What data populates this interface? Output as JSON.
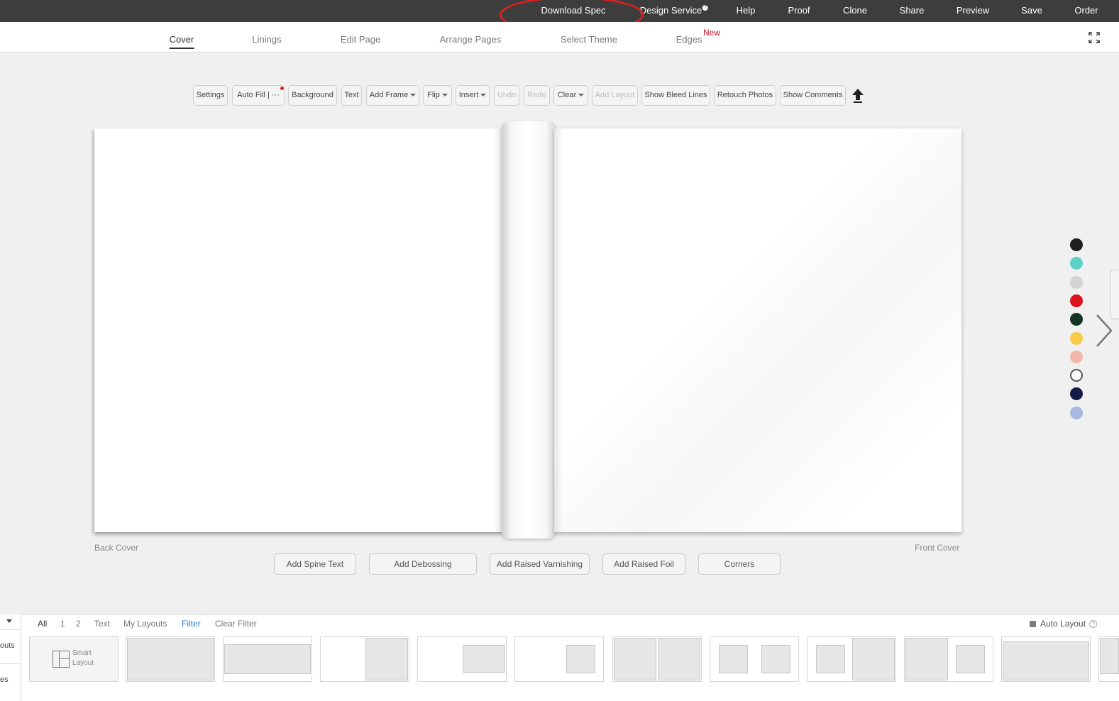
{
  "topbar": {
    "download_spec": "Download Spec",
    "design_service": "Design Service",
    "design_service_badge": "?",
    "help": "Help",
    "proof": "Proof",
    "clone": "Clone",
    "share": "Share",
    "preview": "Preview",
    "save": "Save",
    "order": "Order"
  },
  "tabs": {
    "cover": "Cover",
    "linings": "Linings",
    "edit_page": "Edit Page",
    "arrange_pages": "Arrange Pages",
    "select_theme": "Select Theme",
    "edges": "Edges",
    "new_badge": "New",
    "active": "Cover"
  },
  "toolbar": {
    "settings": "Settings",
    "auto_fill": "Auto Fill",
    "auto_fill_more": "| ···",
    "background": "Background",
    "text": "Text",
    "add_frame": "Add Frame",
    "flip": "Flip",
    "insert": "Insert",
    "undo": "Undo",
    "redo": "Redo",
    "clear": "Clear",
    "add_layout": "Add Layout",
    "show_bleed_lines": "Show Bleed Lines",
    "retouch_photos": "Retouch Photos",
    "show_comments": "Show Comments"
  },
  "cover": {
    "back_label": "Back Cover",
    "front_label": "Front Cover",
    "options": {
      "spine_text": "Add Spine Text",
      "debossing": "Add Debossing",
      "raised_varnishing": "Add Raised Varnishing",
      "raised_foil": "Add Raised Foil",
      "corners": "Corners"
    }
  },
  "swatches": [
    "#1e1e1e",
    "#5dd2c6",
    "#d3d3d3",
    "#d9141f",
    "#123524",
    "#f7c948",
    "#f2b8aa",
    "#ffffff",
    "#141b44",
    "#a7b8e3"
  ],
  "layouts_panel": {
    "left_labels": [
      "outs",
      "es"
    ],
    "filters": {
      "all": "All",
      "one": "1",
      "two": "2",
      "text": "Text",
      "my_layouts": "My Layouts",
      "filter": "Filter",
      "clear_filter": "Clear Filter"
    },
    "auto_layout": "Auto Layout",
    "auto_layout_help": "?",
    "smart_layout_line1": "Smart",
    "smart_layout_line2": "Layout"
  },
  "colors": {
    "topbar": "#3d3d3d",
    "accent_red": "#c8102e",
    "filter_blue": "#2a7fd4"
  }
}
